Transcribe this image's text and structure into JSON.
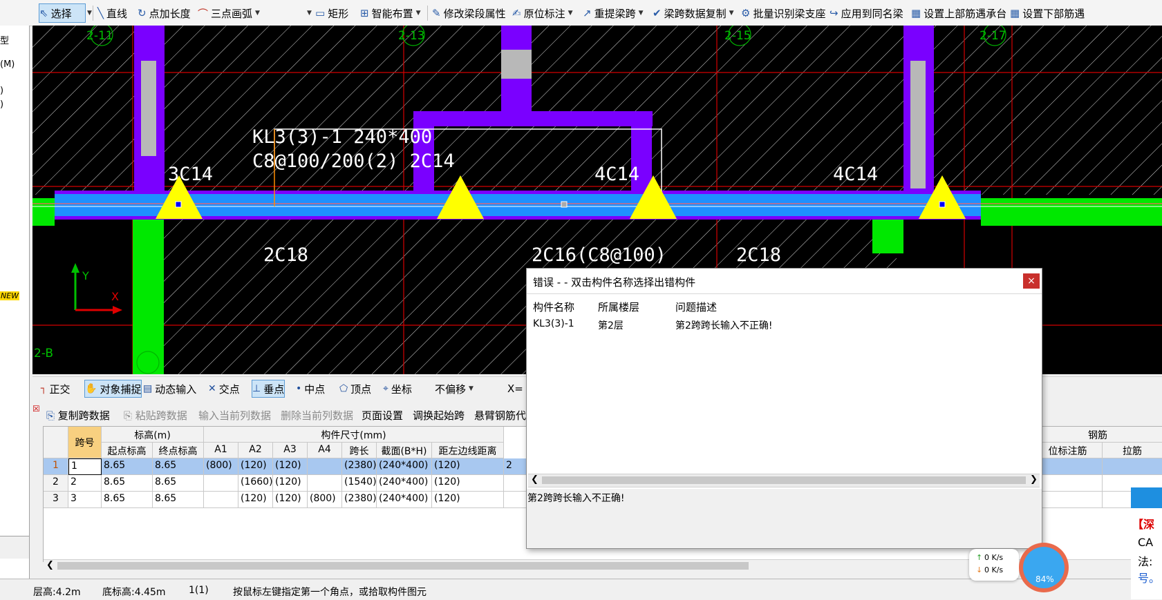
{
  "toolbar": {
    "items": [
      {
        "label": "选择",
        "icon": "cursor-icon",
        "dropdown": true
      },
      {
        "label": "直线",
        "icon": "line-icon"
      },
      {
        "label": "点加长度",
        "icon": "point-length-icon"
      },
      {
        "label": "三点画弧",
        "icon": "arc-icon",
        "dropdown": true
      },
      {
        "label": "矩形",
        "icon": "rectangle-icon"
      },
      {
        "label": "智能布置",
        "icon": "smart-layout-icon",
        "dropdown": true
      },
      {
        "label": "修改梁段属性",
        "icon": "edit-beam-icon"
      },
      {
        "label": "原位标注",
        "icon": "annotate-icon",
        "dropdown": true
      },
      {
        "label": "重提梁跨",
        "icon": "respan-icon",
        "dropdown": true
      },
      {
        "label": "梁跨数据复制",
        "icon": "copy-span-icon"
      },
      {
        "label": "批量识别梁支座",
        "icon": "batch-support-icon"
      },
      {
        "label": "应用到同名梁",
        "icon": "apply-same-icon"
      },
      {
        "label": "设置上部筋遇承台",
        "icon": "top-rebar-icon"
      },
      {
        "label": "设置下部筋遇",
        "icon": "bottom-rebar-icon"
      }
    ]
  },
  "left_panel": {
    "texts": [
      "型",
      "(M)",
      ")",
      ")",
      "NEW"
    ]
  },
  "canvas": {
    "axis_labels": [
      "2-11",
      "2-13",
      "2-15",
      "2-17",
      "2-B"
    ],
    "beam_label": "KL3(3)-1  240*400",
    "stirrup_label": "C8@100/200(2) 2C14",
    "top_rebar": [
      "3C14",
      "4C14",
      "4C14"
    ],
    "bottom_rebar": [
      "2C18",
      "2C16(C8@100)",
      "2C18"
    ],
    "ucs": {
      "y": "Y",
      "x": "X"
    },
    "colors": {
      "beam": "#1e90ff",
      "wall": "#7a00ff",
      "column": "#00e800",
      "support": "#ffff00",
      "grid": "#d40000"
    }
  },
  "snapbar": {
    "items": [
      {
        "label": "正交",
        "icon": "ortho-icon",
        "on": false
      },
      {
        "label": "对象捕捉",
        "icon": "object-snap-icon",
        "on": true
      },
      {
        "label": "动态输入",
        "icon": "dynamic-input-icon",
        "on": false
      },
      {
        "label": "交点",
        "icon": "intersection-icon",
        "on": false
      },
      {
        "label": "垂点",
        "icon": "perpendicular-icon",
        "on": true
      },
      {
        "label": "中点",
        "icon": "midpoint-icon",
        "on": false
      },
      {
        "label": "顶点",
        "icon": "vertex-icon",
        "on": false
      },
      {
        "label": "坐标",
        "icon": "coordinate-icon",
        "on": false
      }
    ],
    "offset": "不偏移",
    "x_label": "X="
  },
  "grid_toolbar": {
    "items": [
      {
        "label": "复制跨数据",
        "disabled": false
      },
      {
        "label": "粘贴跨数据",
        "disabled": true
      },
      {
        "label": "输入当前列数据",
        "disabled": true
      },
      {
        "label": "删除当前列数据",
        "disabled": true
      },
      {
        "label": "页面设置",
        "disabled": false
      },
      {
        "label": "调换起始跨",
        "disabled": false
      },
      {
        "label": "悬臂钢筋代",
        "disabled": false
      }
    ]
  },
  "table": {
    "group_headers": {
      "span_no": "跨号",
      "elevation": "标高(m)",
      "size": "构件尺寸(mm)",
      "rebar": "钢筋"
    },
    "columns": [
      "起点标高",
      "终点标高",
      "A1",
      "A2",
      "A3",
      "A4",
      "跨长",
      "截面(B*H)",
      "距左边线距离"
    ],
    "right_columns": [
      "位标注筋",
      "拉筋"
    ],
    "rows": [
      {
        "idx": "1",
        "span": "1",
        "cells": [
          "8.65",
          "8.65",
          "(800)",
          "(120)",
          "(120)",
          "",
          "(2380)",
          "(240*400)",
          "(120)"
        ],
        "extra": "2"
      },
      {
        "idx": "2",
        "span": "2",
        "cells": [
          "8.65",
          "8.65",
          "",
          "(1660)",
          "(120)",
          "",
          "(1540)",
          "(240*400)",
          "(120)"
        ],
        "extra": ""
      },
      {
        "idx": "3",
        "span": "3",
        "cells": [
          "8.65",
          "8.65",
          "",
          "(120)",
          "(120)",
          "(800)",
          "(2380)",
          "(240*400)",
          "(120)"
        ],
        "extra": ""
      }
    ]
  },
  "statusbar": {
    "floor_height": "层高:4.2m",
    "bottom_elev": "底标高:4.45m",
    "count": "1(1)",
    "hint": "按鼠标左键指定第一个角点，或拾取构件图元"
  },
  "dialog": {
    "title": "错误 - - 双击构件名称选择出错构件",
    "headers": [
      "构件名称",
      "所属楼层",
      "问题描述"
    ],
    "rows": [
      [
        "KL3(3)-1",
        "第2层",
        "第2跨跨长输入不正确!"
      ]
    ],
    "message": "第2跨跨长输入不正确!",
    "close": "×"
  },
  "network": {
    "up": "0  K/s",
    "down": "0  K/s"
  },
  "assistant": {
    "percent": "84%"
  },
  "right_ad": {
    "lines": [
      "【深",
      "CA",
      "法:",
      "号。"
    ]
  }
}
